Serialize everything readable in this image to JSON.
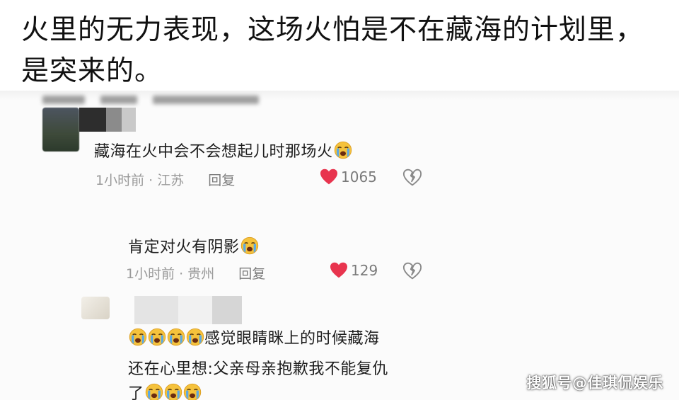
{
  "headline": {
    "text": "火里的无力表现，这场火怕是不在藏海的计划里，是突来的。"
  },
  "comments": [
    {
      "text": "藏海在火中会不会想起儿时那场火",
      "emojis": [
        "loudly-crying-face"
      ],
      "time": "1小时前",
      "location": "江苏",
      "reply_label": "回复",
      "likes": "1065"
    },
    {
      "text": "肯定对火有阴影",
      "emojis": [
        "loudly-crying-face"
      ],
      "time": "1小时前",
      "location": "贵州",
      "reply_label": "回复",
      "likes": "129"
    },
    {
      "lead_emojis": [
        "loudly-crying-face",
        "loudly-crying-face",
        "loudly-crying-face",
        "loudly-crying-face"
      ],
      "line1": "感觉眼睛眯上的时候藏海",
      "line2": "还在心里想:父亲母亲抱歉我不能复仇",
      "line3": "了",
      "tail_emojis": [
        "loudly-crying-face",
        "loudly-crying-face",
        "loudly-crying-face"
      ]
    }
  ],
  "watermark": "搜狐号@佳琪侃娱乐",
  "colors": {
    "heart": "#e8344e",
    "meta_text": "#9a9a9a",
    "emoji_face": "#f5c23c",
    "emoji_tears": "#5aa9e6"
  }
}
